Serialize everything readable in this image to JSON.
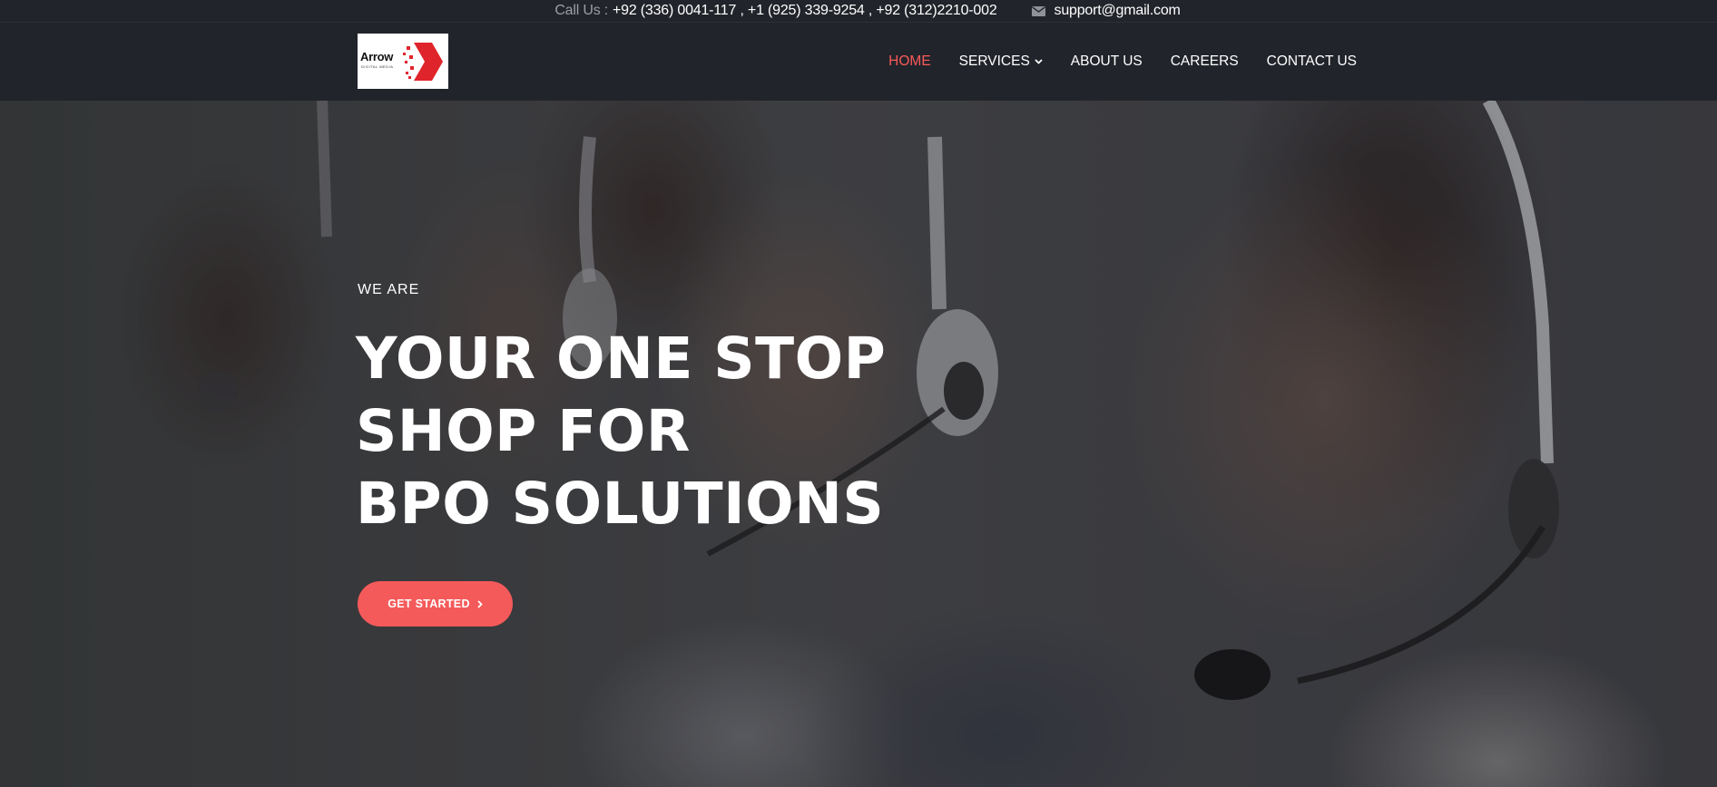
{
  "topbar": {
    "call_label": "Call Us :",
    "phones": "+92 (336) 0041-117 , +1 (925) 339-9254 , +92 (312)2210-002",
    "email": "support@gmail.com",
    "email_icon": "envelope-icon"
  },
  "logo": {
    "text": "Arrow",
    "subtext": "DIGITAL MEDIA",
    "colors": {
      "arrow": "#e0242b"
    }
  },
  "nav": {
    "items": [
      {
        "label": "HOME",
        "active": true
      },
      {
        "label": "SERVICES",
        "dropdown": true
      },
      {
        "label": "ABOUT US"
      },
      {
        "label": "CAREERS"
      },
      {
        "label": "CONTACT US"
      }
    ]
  },
  "hero": {
    "eyebrow": "WE ARE",
    "headline_lines": [
      "YOUR ONE STOP",
      "SHOP FOR",
      "BPO SOLUTIONS"
    ],
    "cta_label": "GET STARTED",
    "cta_icon": "chevron-right-icon"
  },
  "colors": {
    "accent": "#f55a5a",
    "nav_active": "#f85a5a",
    "header_bg": "#22242b"
  }
}
